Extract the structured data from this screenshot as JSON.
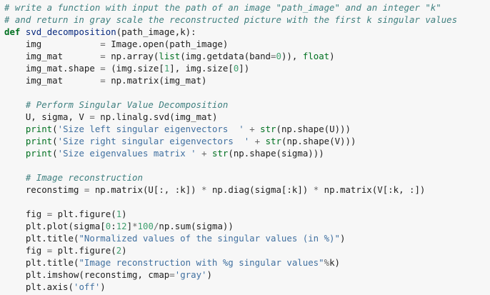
{
  "code": {
    "lines": [
      [
        {
          "t": "# write a function with input the path of an image \"path_image\" and an integer \"k\"",
          "c": "c"
        }
      ],
      [
        {
          "t": "# and return in gray scale the reconstructed picture with the first k singular values",
          "c": "c"
        }
      ],
      [
        {
          "t": "def",
          "c": "k"
        },
        {
          "t": " ",
          "c": "t"
        },
        {
          "t": "svd_decomposition",
          "c": "f"
        },
        {
          "t": "(path_image,k):",
          "c": "t"
        }
      ],
      [
        {
          "t": "    img           ",
          "c": "t"
        },
        {
          "t": "=",
          "c": "o"
        },
        {
          "t": " Image.open(path_image)",
          "c": "t"
        }
      ],
      [
        {
          "t": "    img_mat       ",
          "c": "t"
        },
        {
          "t": "=",
          "c": "o"
        },
        {
          "t": " np.array(",
          "c": "t"
        },
        {
          "t": "list",
          "c": "b"
        },
        {
          "t": "(img.getdata(band",
          "c": "t"
        },
        {
          "t": "=",
          "c": "o"
        },
        {
          "t": "0",
          "c": "n"
        },
        {
          "t": ")), ",
          "c": "t"
        },
        {
          "t": "float",
          "c": "b"
        },
        {
          "t": ")",
          "c": "t"
        }
      ],
      [
        {
          "t": "    img_mat.shape ",
          "c": "t"
        },
        {
          "t": "=",
          "c": "o"
        },
        {
          "t": " (img.size[",
          "c": "t"
        },
        {
          "t": "1",
          "c": "n"
        },
        {
          "t": "], img.size[",
          "c": "t"
        },
        {
          "t": "0",
          "c": "n"
        },
        {
          "t": "])",
          "c": "t"
        }
      ],
      [
        {
          "t": "    img_mat       ",
          "c": "t"
        },
        {
          "t": "=",
          "c": "o"
        },
        {
          "t": " np.matrix(img_mat)",
          "c": "t"
        }
      ],
      [
        {
          "t": "",
          "c": "t"
        }
      ],
      [
        {
          "t": "    ",
          "c": "t"
        },
        {
          "t": "# Perform Singular Value Decomposition",
          "c": "c"
        }
      ],
      [
        {
          "t": "    U, sigma, V ",
          "c": "t"
        },
        {
          "t": "=",
          "c": "o"
        },
        {
          "t": " np.linalg.svd(img_mat)",
          "c": "t"
        }
      ],
      [
        {
          "t": "    ",
          "c": "t"
        },
        {
          "t": "print",
          "c": "b"
        },
        {
          "t": "(",
          "c": "t"
        },
        {
          "t": "'Size left singular eigenvectors  '",
          "c": "s"
        },
        {
          "t": " ",
          "c": "t"
        },
        {
          "t": "+",
          "c": "o"
        },
        {
          "t": " ",
          "c": "t"
        },
        {
          "t": "str",
          "c": "b"
        },
        {
          "t": "(np.shape(U)))",
          "c": "t"
        }
      ],
      [
        {
          "t": "    ",
          "c": "t"
        },
        {
          "t": "print",
          "c": "b"
        },
        {
          "t": "(",
          "c": "t"
        },
        {
          "t": "'Size right singular eigenvectors  '",
          "c": "s"
        },
        {
          "t": " ",
          "c": "t"
        },
        {
          "t": "+",
          "c": "o"
        },
        {
          "t": " ",
          "c": "t"
        },
        {
          "t": "str",
          "c": "b"
        },
        {
          "t": "(np.shape(V)))",
          "c": "t"
        }
      ],
      [
        {
          "t": "    ",
          "c": "t"
        },
        {
          "t": "print",
          "c": "b"
        },
        {
          "t": "(",
          "c": "t"
        },
        {
          "t": "'Size eigenvalues matrix '",
          "c": "s"
        },
        {
          "t": " ",
          "c": "t"
        },
        {
          "t": "+",
          "c": "o"
        },
        {
          "t": " ",
          "c": "t"
        },
        {
          "t": "str",
          "c": "b"
        },
        {
          "t": "(np.shape(sigma)))",
          "c": "t"
        }
      ],
      [
        {
          "t": "",
          "c": "t"
        }
      ],
      [
        {
          "t": "    ",
          "c": "t"
        },
        {
          "t": "# Image reconstruction",
          "c": "c"
        }
      ],
      [
        {
          "t": "    reconstimg ",
          "c": "t"
        },
        {
          "t": "=",
          "c": "o"
        },
        {
          "t": " np.matrix(U[:, :k]) ",
          "c": "t"
        },
        {
          "t": "*",
          "c": "o"
        },
        {
          "t": " np.diag(sigma[:k]) ",
          "c": "t"
        },
        {
          "t": "*",
          "c": "o"
        },
        {
          "t": " np.matrix(V[:k, :])",
          "c": "t"
        }
      ],
      [
        {
          "t": "",
          "c": "t"
        }
      ],
      [
        {
          "t": "    fig ",
          "c": "t"
        },
        {
          "t": "=",
          "c": "o"
        },
        {
          "t": " plt.figure(",
          "c": "t"
        },
        {
          "t": "1",
          "c": "n"
        },
        {
          "t": ")",
          "c": "t"
        }
      ],
      [
        {
          "t": "    plt.plot(sigma[",
          "c": "t"
        },
        {
          "t": "0",
          "c": "n"
        },
        {
          "t": ":",
          "c": "t"
        },
        {
          "t": "12",
          "c": "n"
        },
        {
          "t": "]",
          "c": "t"
        },
        {
          "t": "*",
          "c": "o"
        },
        {
          "t": "100",
          "c": "n"
        },
        {
          "t": "/",
          "c": "o"
        },
        {
          "t": "np.sum(sigma))",
          "c": "t"
        }
      ],
      [
        {
          "t": "    plt.title(",
          "c": "t"
        },
        {
          "t": "\"Normalized values of the singular values (in %)\"",
          "c": "s"
        },
        {
          "t": ")",
          "c": "t"
        }
      ],
      [
        {
          "t": "    fig ",
          "c": "t"
        },
        {
          "t": "=",
          "c": "o"
        },
        {
          "t": " plt.figure(",
          "c": "t"
        },
        {
          "t": "2",
          "c": "n"
        },
        {
          "t": ")",
          "c": "t"
        }
      ],
      [
        {
          "t": "    plt.title(",
          "c": "t"
        },
        {
          "t": "\"Image reconstruction with %g singular values\"",
          "c": "s"
        },
        {
          "t": "%",
          "c": "o"
        },
        {
          "t": "k)",
          "c": "t"
        }
      ],
      [
        {
          "t": "    plt.imshow(reconstimg, cmap",
          "c": "t"
        },
        {
          "t": "=",
          "c": "o"
        },
        {
          "t": "'gray'",
          "c": "s"
        },
        {
          "t": ")",
          "c": "t"
        }
      ],
      [
        {
          "t": "    plt.axis(",
          "c": "t"
        },
        {
          "t": "'off'",
          "c": "s"
        },
        {
          "t": ")",
          "c": "t"
        }
      ]
    ]
  },
  "colors": {
    "background": "#f7f7f7",
    "comment": "#408080",
    "keyword": "#007020",
    "function_name": "#06287e",
    "string": "#4070a0",
    "number": "#40a070",
    "operator": "#666666",
    "text": "#202020"
  }
}
